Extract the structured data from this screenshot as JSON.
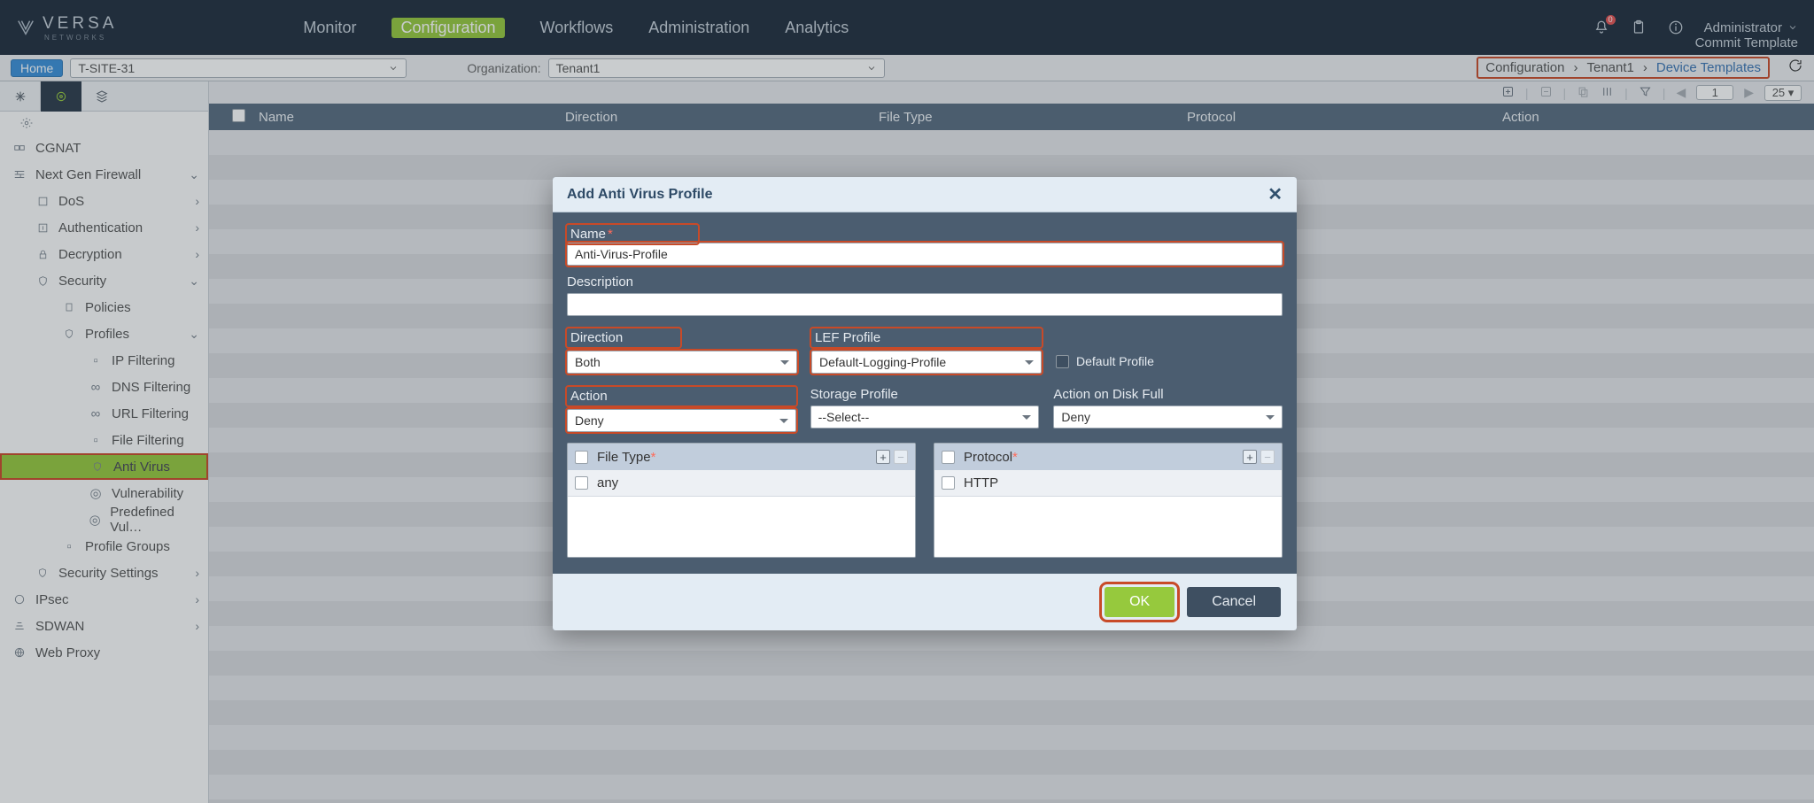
{
  "brand": {
    "name": "VERSA",
    "sub": "NETWORKS"
  },
  "topTabs": {
    "monitor": "Monitor",
    "configuration": "Configuration",
    "workflows": "Workflows",
    "administration": "Administration",
    "analytics": "Analytics"
  },
  "topRight": {
    "notifBadge": "0",
    "admin": "Administrator",
    "commit": "Commit Template"
  },
  "subbar": {
    "home": "Home",
    "site": "T-SITE-31",
    "orgLabel": "Organization:",
    "org": "Tenant1",
    "crumb": {
      "configuration": "Configuration",
      "tenant": "Tenant1",
      "deviceTemplates": "Device Templates"
    }
  },
  "toolbar": {
    "page": "1",
    "pageSize": "25"
  },
  "table": {
    "headers": {
      "name": "Name",
      "direction": "Direction",
      "fileType": "File Type",
      "protocol": "Protocol",
      "action": "Action"
    }
  },
  "sidebar": {
    "cgnat": "CGNAT",
    "ngfw": "Next Gen Firewall",
    "dos": "DoS",
    "auth": "Authentication",
    "decryption": "Decryption",
    "security": "Security",
    "policies": "Policies",
    "profiles": "Profiles",
    "ipFiltering": "IP Filtering",
    "dnsFiltering": "DNS Filtering",
    "urlFiltering": "URL Filtering",
    "fileFiltering": "File Filtering",
    "antiVirus": "Anti Virus",
    "vulnerability": "Vulnerability",
    "predefined": "Predefined Vul…",
    "profileGroups": "Profile Groups",
    "securitySettings": "Security Settings",
    "ipsec": "IPsec",
    "sdwan": "SDWAN",
    "webProxy": "Web Proxy"
  },
  "modal": {
    "title": "Add Anti Virus Profile",
    "labels": {
      "name": "Name",
      "description": "Description",
      "direction": "Direction",
      "lefProfile": "LEF Profile",
      "defaultProfile": "Default Profile",
      "action": "Action",
      "storageProfile": "Storage Profile",
      "actionDiskFull": "Action on Disk Full",
      "fileType": "File Type",
      "protocol": "Protocol"
    },
    "values": {
      "name": "Anti-Virus-Profile",
      "description": "",
      "direction": "Both",
      "lefProfile": "Default-Logging-Profile",
      "action": "Deny",
      "storageProfile": "--Select--",
      "actionDiskFull": "Deny",
      "fileTypeItem": "any",
      "protocolItem": "HTTP"
    },
    "buttons": {
      "ok": "OK",
      "cancel": "Cancel"
    }
  }
}
